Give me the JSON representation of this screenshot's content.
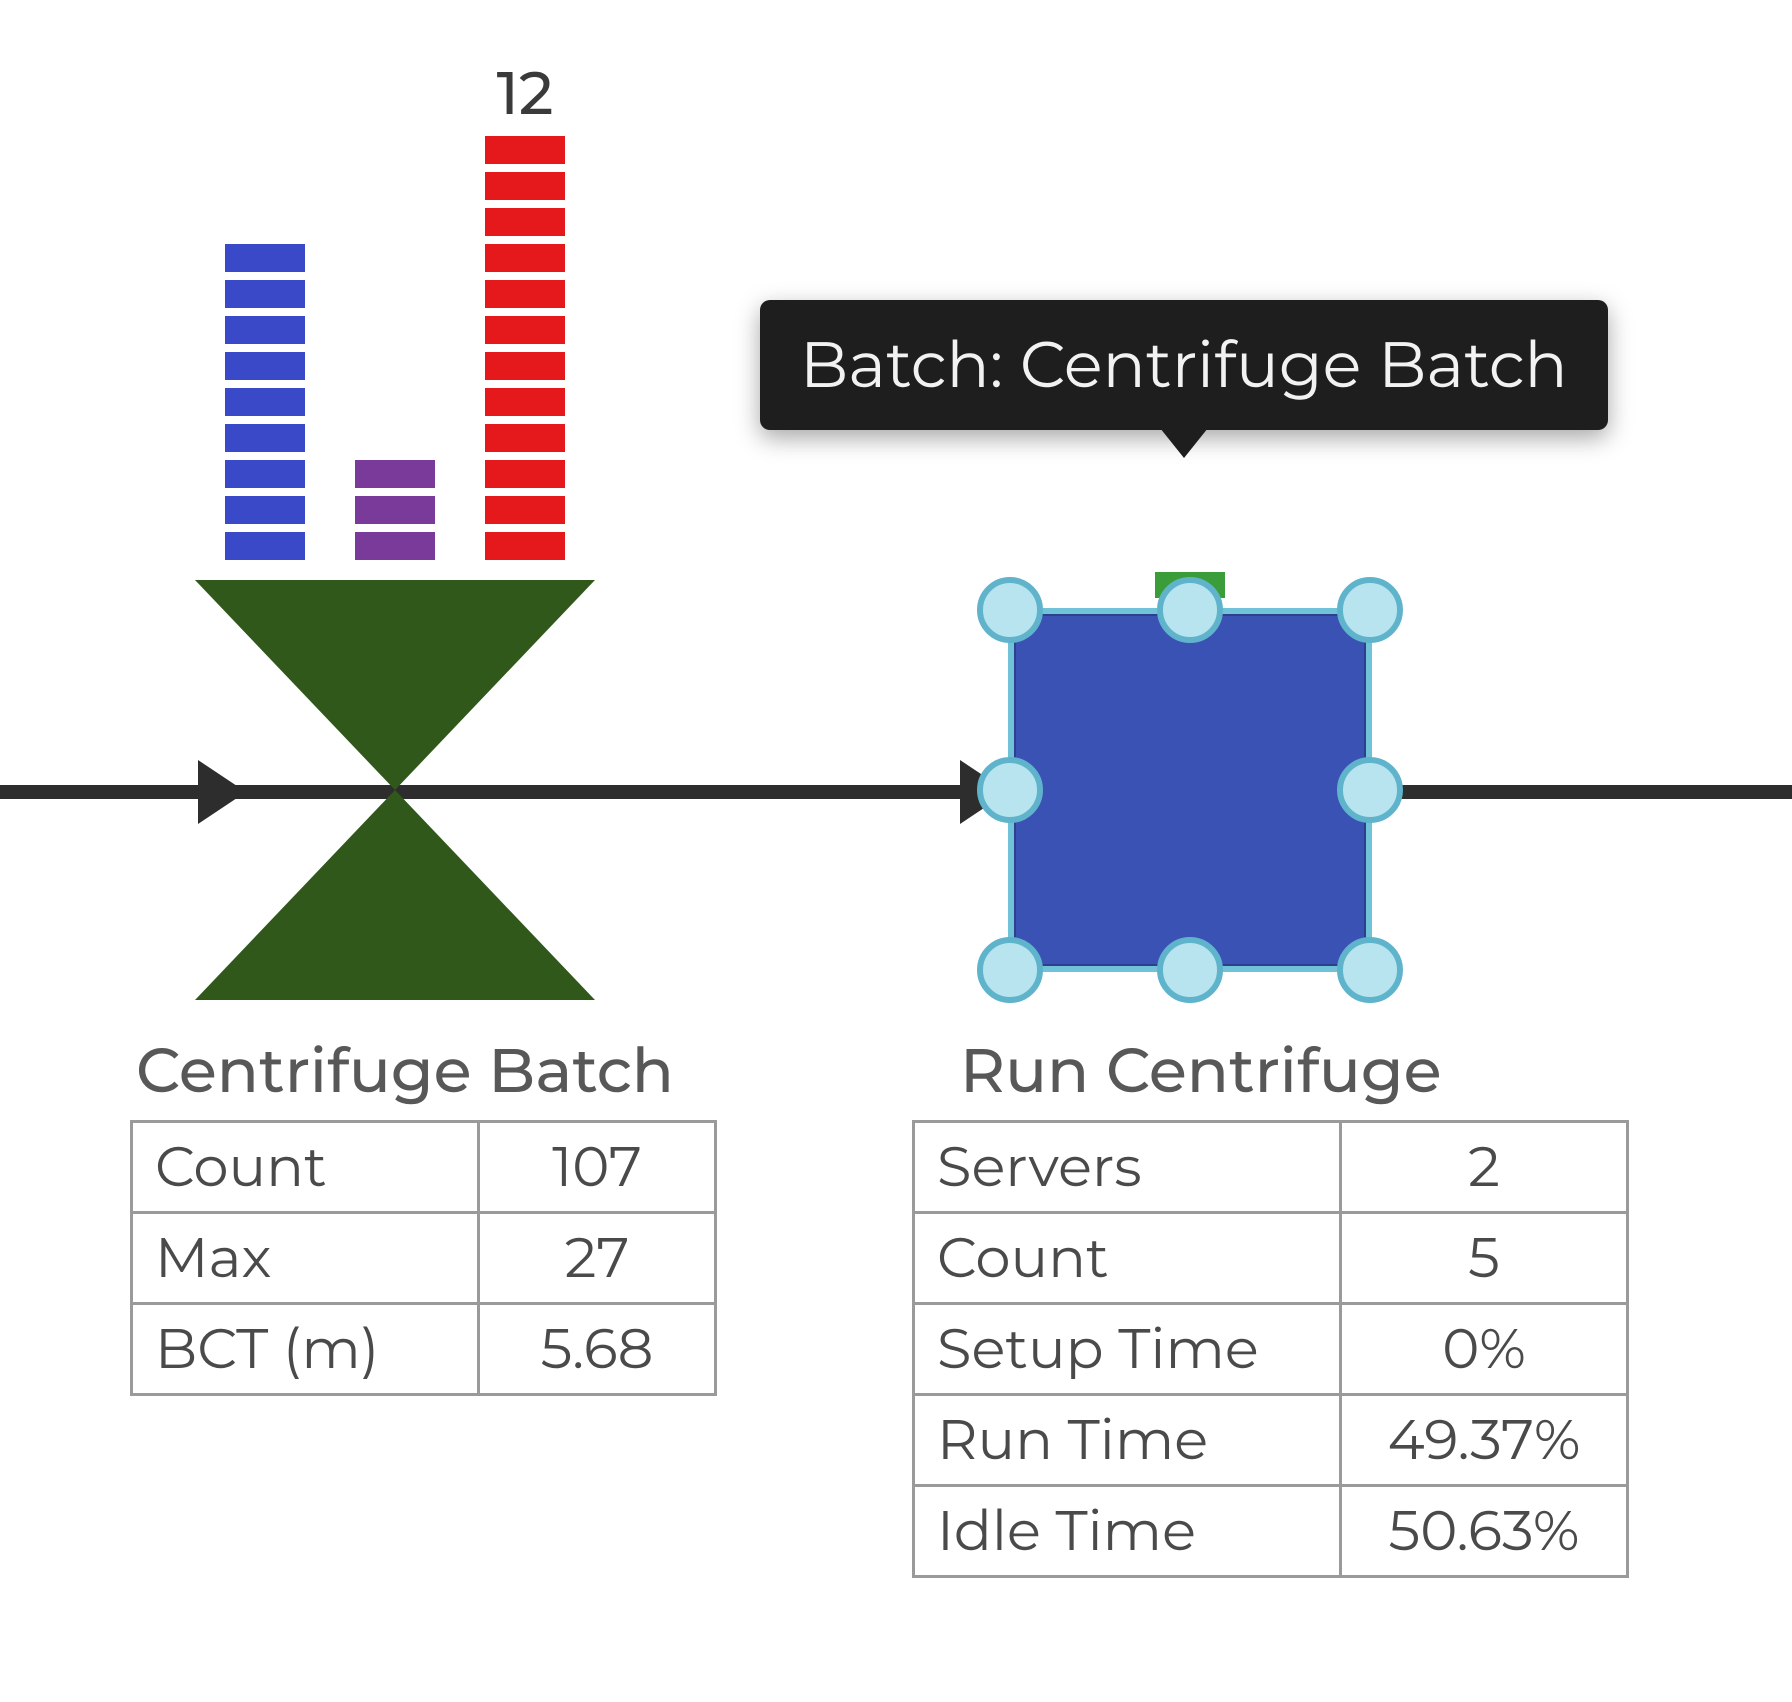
{
  "tooltip": {
    "text": "Batch: Centrifuge Batch"
  },
  "batch_node": {
    "title": "Centrifuge Batch",
    "queues": {
      "blue": {
        "count": 9
      },
      "purple": {
        "count": 3
      },
      "red": {
        "count": 12,
        "label": "12"
      }
    },
    "stats": [
      {
        "label": "Count",
        "value": "107"
      },
      {
        "label": "Max",
        "value": "27"
      },
      {
        "label": "BCT (m)",
        "value": "5.68"
      }
    ]
  },
  "activity_node": {
    "title": "Run Centrifuge",
    "selected": true,
    "stats": [
      {
        "label": "Servers",
        "value": "2"
      },
      {
        "label": "Count",
        "value": "5"
      },
      {
        "label": "Setup Time",
        "value": "0%"
      },
      {
        "label": "Run Time",
        "value": "49.37%"
      },
      {
        "label": "Idle Time",
        "value": "50.63%"
      }
    ]
  },
  "colors": {
    "batch_fill": "#30581b",
    "activity_fill": "#3b52b5",
    "handle": "#b8e4f0",
    "q_blue": "#3a49c8",
    "q_purple": "#7a3a9a",
    "q_red": "#e5191c",
    "progress": "#3a9d3a"
  }
}
